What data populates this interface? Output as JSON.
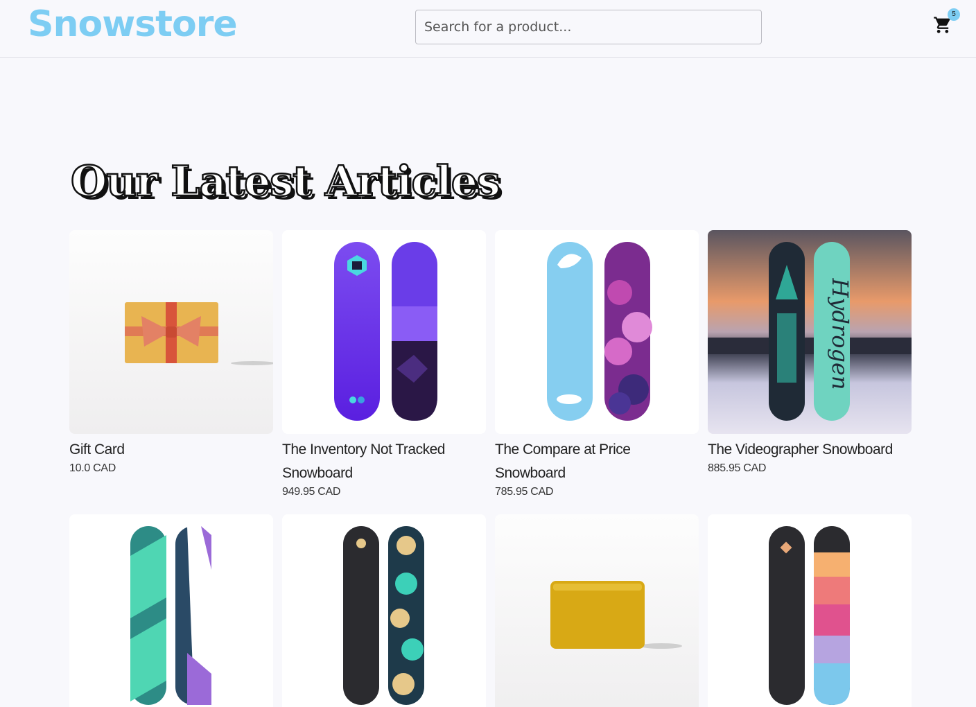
{
  "header": {
    "logo": "Snowstore",
    "search_placeholder": "Search for a product...",
    "cart_count": "5",
    "cart_icon": "cart-icon"
  },
  "section": {
    "title": "Our Latest Articles"
  },
  "products": [
    {
      "name": "Gift Card",
      "price": "10.0 CAD"
    },
    {
      "name": "The Inventory Not Tracked Snowboard",
      "price": "949.95 CAD"
    },
    {
      "name": "The Compare at Price Snowboard",
      "price": "785.95 CAD"
    },
    {
      "name": "The Videographer Snowboard",
      "price": "885.95 CAD"
    },
    {
      "name": "",
      "price": ""
    },
    {
      "name": "",
      "price": ""
    },
    {
      "name": "",
      "price": ""
    },
    {
      "name": "",
      "price": ""
    }
  ],
  "colors": {
    "brand": "#7dcdf3",
    "background": "#f8f8fc"
  }
}
